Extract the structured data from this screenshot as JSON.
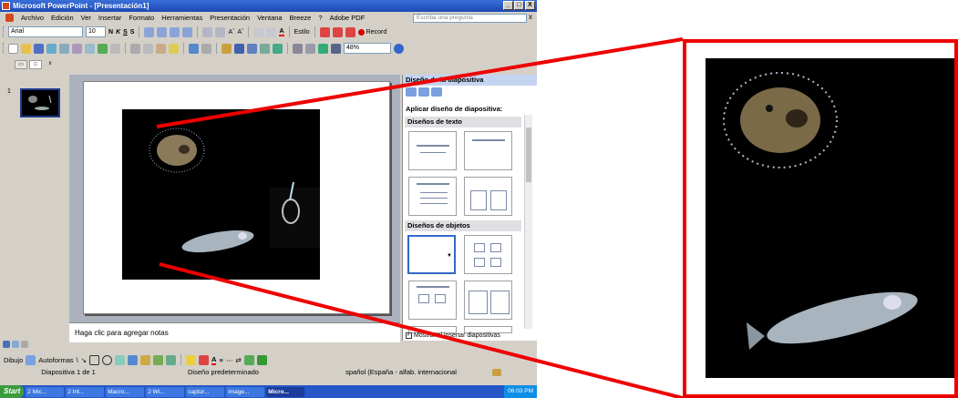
{
  "window": {
    "title": "Microsoft PowerPoint - [Presentación1]",
    "controls": [
      "_",
      "□",
      "X"
    ]
  },
  "menubar": {
    "items": [
      "Archivo",
      "Edición",
      "Ver",
      "Insertar",
      "Formato",
      "Herramientas",
      "Presentación",
      "Ventana",
      "Breeze",
      "?",
      "Adobe PDF"
    ],
    "ask_placeholder": "Escriba una pregunta",
    "close_doc": "x"
  },
  "format_toolbar": {
    "font": "Arial",
    "size": "10",
    "bold": "N",
    "italic": "K",
    "underline": "S",
    "shadow": "S",
    "font_grow": "Aˆ",
    "font_shrink": "Aˇ",
    "font_color": "A",
    "design": "Estilo",
    "record": "Record"
  },
  "standard_toolbar": {
    "zoom": "48%"
  },
  "outline_pane": {
    "tabs": [
      "▭",
      "□",
      "x"
    ],
    "slide_number": "1"
  },
  "notes": {
    "placeholder": "Haga clic para agregar notas"
  },
  "task_pane": {
    "title": "Diseño de la diapositiva",
    "apply_label": "Aplicar diseño de diapositiva:",
    "text_layouts_header": "Diseños de texto",
    "object_layouts_header": "Diseños de objetos",
    "show_checkbox_label": "Mostrar al insertar diapositivas",
    "show_checked": true
  },
  "drawing_toolbar": {
    "draw": "Dibujo",
    "autoshapes": "Autoformas"
  },
  "status_bar": {
    "slide_info": "Diapositiva 1 de 1",
    "design": "Diseño predeterminado",
    "language": "spañol (España - alfab. internacional"
  },
  "taskbar": {
    "start": "Start",
    "buttons": [
      "2 Mic...",
      "2 Int...",
      "Macro...",
      "2 Wi...",
      "captur...",
      "image...",
      "Micro..."
    ],
    "clock": "06:03 PM"
  },
  "colors": {
    "callout": "#e00000",
    "title_bar": "#1c49b5",
    "slide_background": "#000000"
  }
}
